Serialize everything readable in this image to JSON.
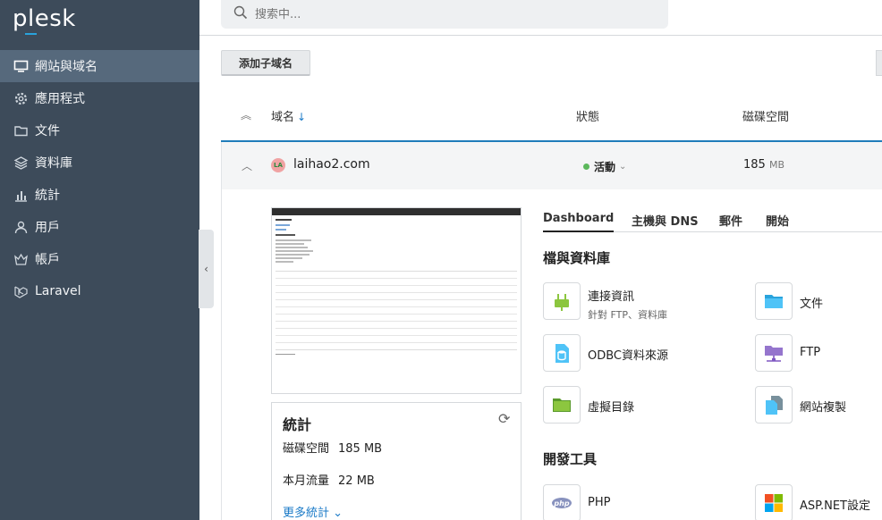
{
  "app": {
    "logo": "plesk",
    "accent": "#29a3dc",
    "sidebar_bg": "#3d4b5a",
    "active_bg": "#56697c"
  },
  "sidebar": {
    "items": [
      {
        "label": "網站與域名",
        "icon": "monitor-icon"
      },
      {
        "label": "應用程式",
        "icon": "gear-icon"
      },
      {
        "label": "文件",
        "icon": "folder-icon"
      },
      {
        "label": "資料庫",
        "icon": "layers-icon"
      },
      {
        "label": "統計",
        "icon": "bar-chart-icon"
      },
      {
        "label": "用戶",
        "icon": "user-icon"
      },
      {
        "label": "帳戶",
        "icon": "crown-icon"
      },
      {
        "label": "Laravel",
        "icon": "laravel-icon"
      }
    ]
  },
  "search": {
    "placeholder": "搜索中..."
  },
  "toolbar": {
    "add_subdomain": "添加子域名"
  },
  "table": {
    "headers": {
      "domain": "域名",
      "status": "狀態",
      "disk": "磁碟空間"
    },
    "row": {
      "favicon": "LA",
      "domain": "laihao2.com",
      "status": "活動",
      "disk_value": "185",
      "disk_unit": "MB"
    }
  },
  "stats": {
    "title": "統計",
    "disk_label": "磁碟空間",
    "disk_value": "185 MB",
    "traffic_label": "本月流量",
    "traffic_value": "22 MB",
    "more": "更多統計"
  },
  "tabs": [
    "Dashboard",
    "主機與 DNS",
    "郵件",
    "開始"
  ],
  "sections": {
    "files_db": {
      "title": "檔與資料庫",
      "tools": [
        {
          "label": "連接資訊",
          "sub": "針對 FTP、資料庫",
          "icon": "plug-icon"
        },
        {
          "label": "文件",
          "icon": "folder-icon"
        },
        {
          "label": "ODBC資料來源",
          "icon": "database-file-icon"
        },
        {
          "label": "FTP",
          "icon": "ftp-icon"
        },
        {
          "label": "虛擬目錄",
          "icon": "virtual-folder-icon"
        },
        {
          "label": "網站複製",
          "icon": "copy-site-icon"
        }
      ]
    },
    "dev": {
      "title": "開發工具",
      "tools": [
        {
          "label": "PHP",
          "icon": "php-icon"
        },
        {
          "label": "ASP.NET設定",
          "icon": "aspnet-icon"
        }
      ]
    }
  }
}
